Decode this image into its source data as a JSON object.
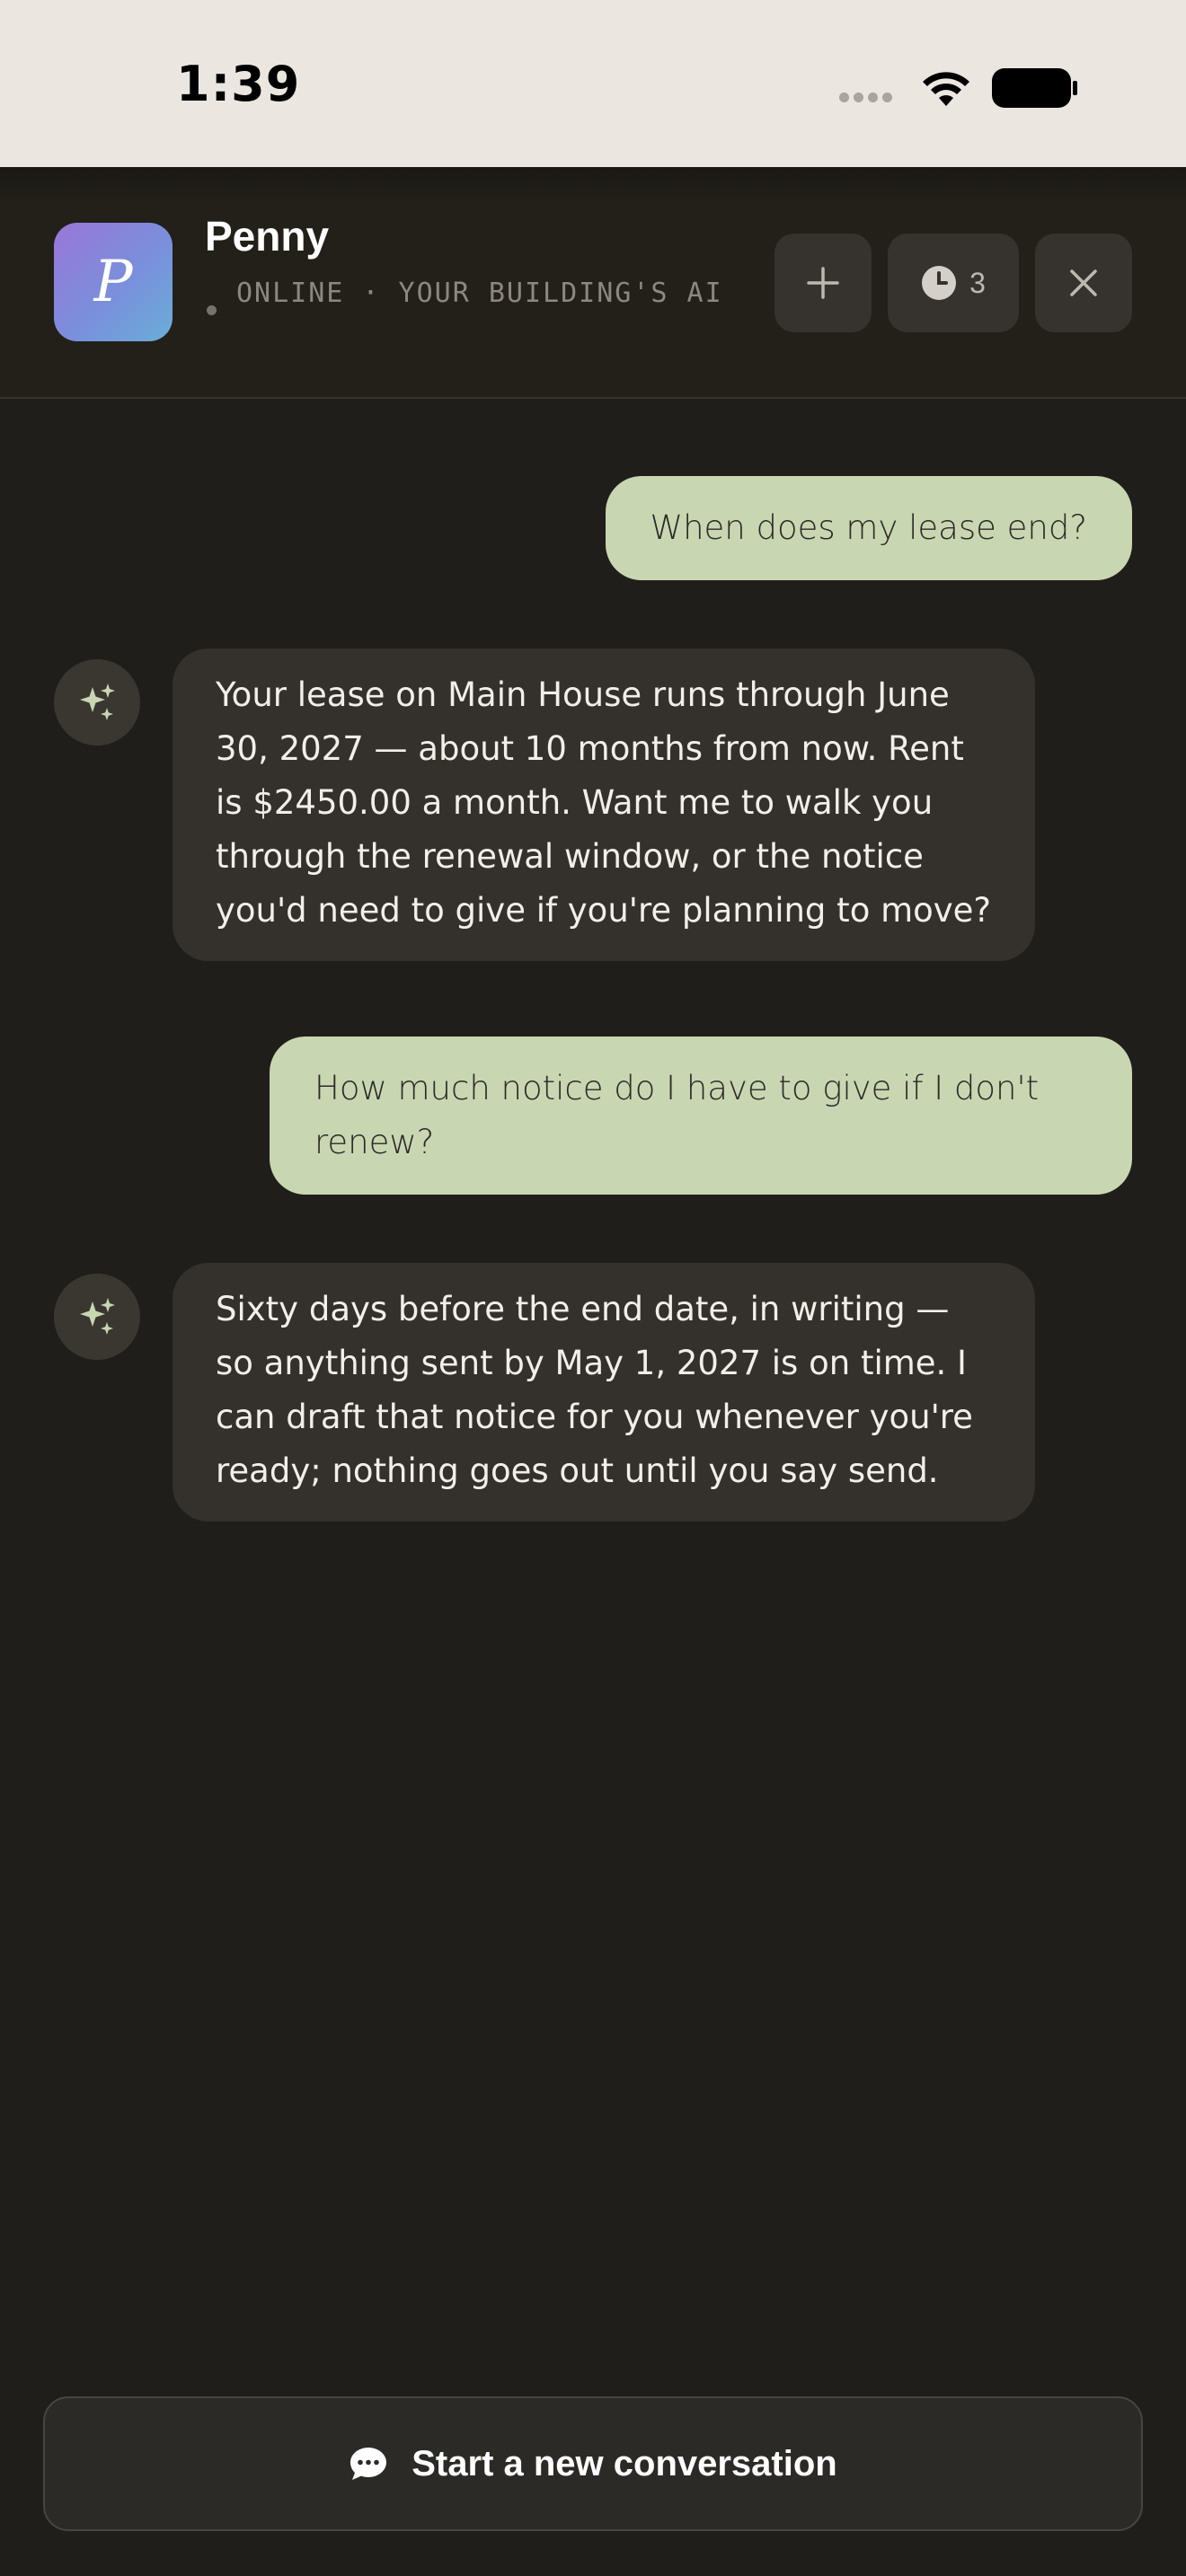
{
  "status_bar": {
    "time": "1:39"
  },
  "header": {
    "avatar_letter": "P",
    "agent_name": "Penny",
    "agent_status": "ONLINE · YOUR BUILDING'S AI",
    "history_count": "3",
    "avatar_gradient": [
      "#9a76d8",
      "#6aaed8"
    ]
  },
  "messages": [
    {
      "role": "user",
      "text": "When does my lease end?"
    },
    {
      "role": "assistant",
      "text": "Your lease on Main House runs through June 30, 2027 — about 10 months from now. Rent is $2450.00 a month. Want me to walk you through the renewal window, or the notice you'd need to give if you're planning to move?"
    },
    {
      "role": "user",
      "text": "How much notice do I have to give if I don't renew?"
    },
    {
      "role": "assistant",
      "text": "Sixty days before the end date, in writing — so anything sent by May 1, 2027 is on time. I can draft that notice for you whenever you're ready; nothing goes out until you say send."
    }
  ],
  "footer": {
    "new_conversation_label": "Start a new conversation"
  },
  "colors": {
    "background": "#201e1a",
    "user_bubble": "#c9d6b2",
    "assistant_bubble": "#34312c",
    "sparkle": "#c9d6b2"
  }
}
